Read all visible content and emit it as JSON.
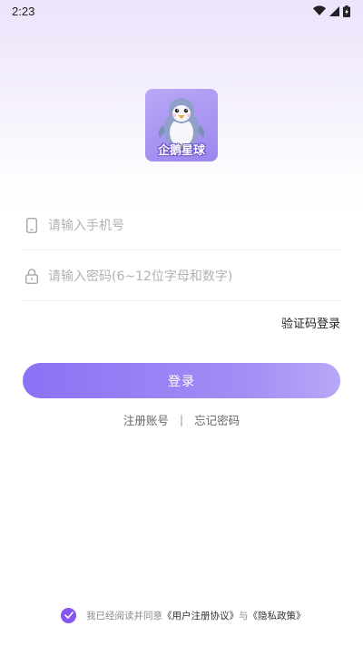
{
  "status_bar": {
    "time": "2:23"
  },
  "logo": {
    "text": "企鹅星球"
  },
  "phone_field": {
    "placeholder": "请输入手机号",
    "value": ""
  },
  "password_field": {
    "placeholder": "请输入密码(6~12位字母和数字)",
    "value": ""
  },
  "sms_login_label": "验证码登录",
  "login_button_label": "登录",
  "links": {
    "register": "注册账号",
    "separator": "|",
    "forgot": "忘记密码"
  },
  "agreement": {
    "checked": true,
    "prefix": "我已经阅读并同意",
    "user_agreement": "《用户注册协议》",
    "conjunction": "与",
    "privacy_policy": "《隐私政策》"
  },
  "colors": {
    "accent": "#8654f0",
    "button_start": "#8c71f5",
    "button_end": "#b8a7f7"
  }
}
